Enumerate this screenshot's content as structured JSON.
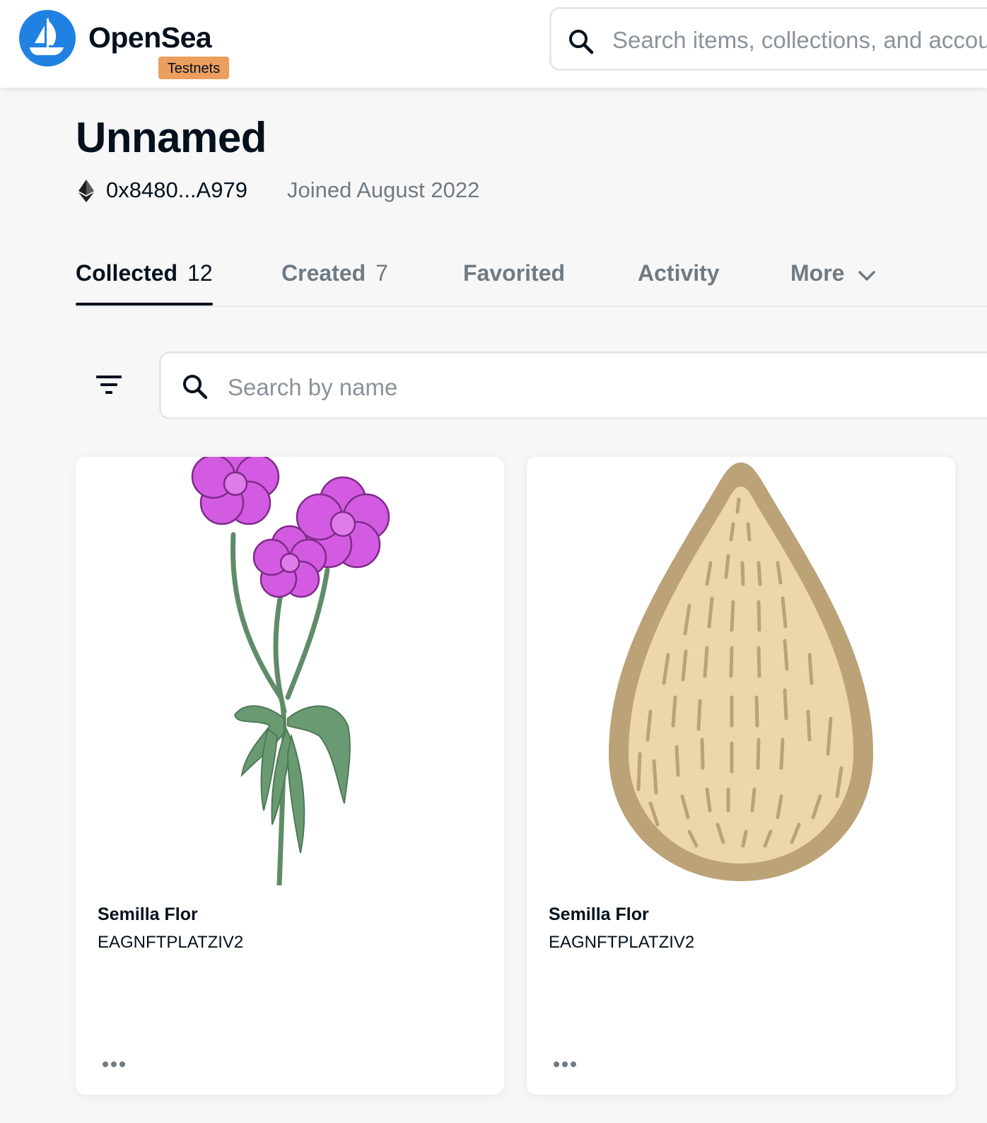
{
  "header": {
    "brand": "OpenSea",
    "badge": "Testnets",
    "search_placeholder": "Search items, collections, and accounts"
  },
  "profile": {
    "name": "Unnamed",
    "address": "0x8480...A979",
    "joined": "Joined August 2022"
  },
  "tabs": [
    {
      "label": "Collected",
      "count": "12"
    },
    {
      "label": "Created",
      "count": "7"
    },
    {
      "label": "Favorited"
    },
    {
      "label": "Activity"
    },
    {
      "label": "More"
    }
  ],
  "filters": {
    "search_placeholder": "Search by name"
  },
  "items": [
    {
      "title": "Semilla Flor",
      "collection": "EAGNFTPLATZIV2",
      "image": "pink-flowers"
    },
    {
      "title": "Semilla Flor",
      "collection": "EAGNFTPLATZIV2",
      "image": "seed"
    }
  ],
  "colors": {
    "accent": "#2081e2",
    "badge": "#eb9e5e",
    "flower": "#d35be1",
    "stem": "#6a9a72",
    "seed_fill": "#ecd6aa",
    "seed_outline": "#bba277"
  }
}
